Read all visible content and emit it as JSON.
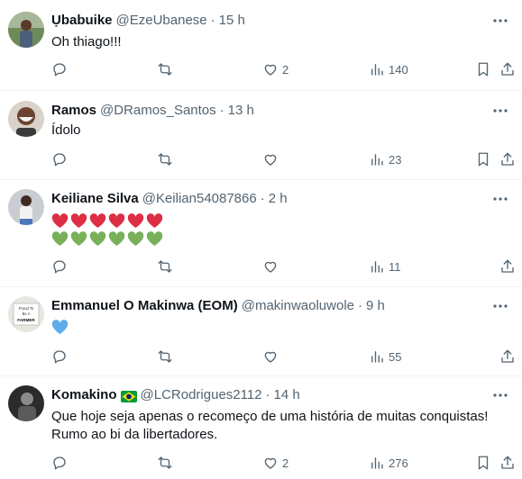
{
  "tweets": [
    {
      "name": "Ụbabuike",
      "handle": "@EzeUbanese",
      "dot": "·",
      "time": "15 h",
      "text": "Oh thiago!!!",
      "likes": "2",
      "views": "140",
      "replies": "",
      "retweets": ""
    },
    {
      "name": "Ramos",
      "handle": "@DRamos_Santos",
      "dot": "·",
      "time": "13 h",
      "text": "Ídolo",
      "likes": "",
      "views": "23",
      "replies": "",
      "retweets": ""
    },
    {
      "name": "Keiliane Silva",
      "handle": "@Keilian54087866",
      "dot": "·",
      "time": "2 h",
      "text": "",
      "emoji_rows": [
        {
          "emoji": "red-heart",
          "count": 6,
          "color": "#dd2e44"
        },
        {
          "emoji": "green-heart",
          "count": 6,
          "color": "#78b159"
        }
      ],
      "likes": "",
      "views": "11",
      "replies": "",
      "retweets": ""
    },
    {
      "name": "Emmanuel O Makinwa (EOM)",
      "handle": "@makinwaoluwole",
      "dot": "·",
      "time": "9 h",
      "text": "",
      "emoji_rows": [
        {
          "emoji": "blue-heart",
          "count": 1,
          "color": "#5dadec"
        }
      ],
      "avatar_text": "Proud To Be A FARMER",
      "likes": "",
      "views": "55",
      "replies": "",
      "retweets": ""
    },
    {
      "name": "Komakino",
      "flag": "brazil-flag",
      "handle": "@LCRodrigues2112",
      "dot": "·",
      "time": "14 h",
      "text_lines": [
        "Que hoje seja apenas o recomeço de uma história de muitas conquistas!",
        "Rumo ao bi da libertadores."
      ],
      "likes": "2",
      "views": "276",
      "replies": "",
      "retweets": ""
    }
  ],
  "colors": {
    "text": "#0f1419",
    "secondary": "#536471",
    "divider": "#eff3f4"
  }
}
